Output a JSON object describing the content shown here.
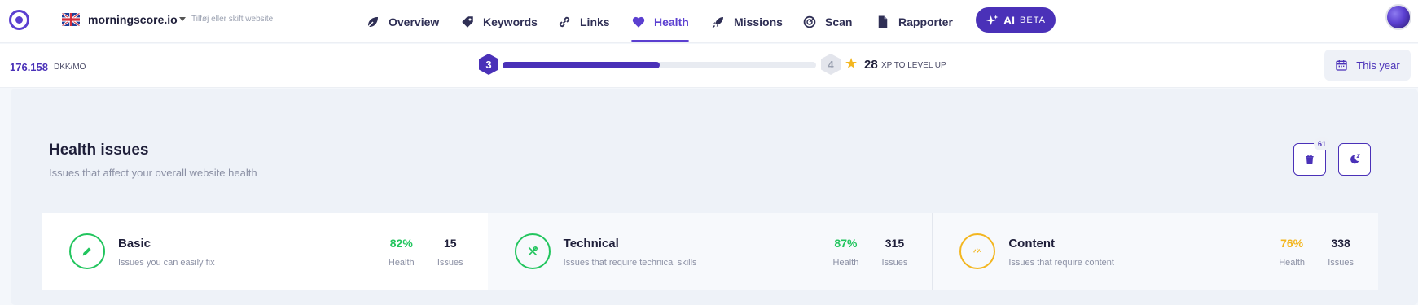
{
  "colors": {
    "accent": "#4a31b8",
    "green": "#22c55e",
    "amber": "#f3b61f",
    "star": "#f3b61f"
  },
  "topnav": {
    "site": {
      "name": "morningscore.io",
      "hint": "Tilføj eller skift website",
      "flag": "uk-flag-icon"
    },
    "items": [
      {
        "label": "Overview",
        "icon": "overview-icon",
        "active": false
      },
      {
        "label": "Keywords",
        "icon": "keyword-tag-icon",
        "active": false
      },
      {
        "label": "Links",
        "icon": "link-icon",
        "active": false
      },
      {
        "label": "Health",
        "icon": "heart-icon",
        "active": true
      },
      {
        "label": "Missions",
        "icon": "rocket-icon",
        "active": false
      },
      {
        "label": "Scan",
        "icon": "scan-icon",
        "active": false
      },
      {
        "label": "Rapporter",
        "icon": "document-icon",
        "active": false
      }
    ],
    "ai": {
      "label": "AI",
      "tag": "BETA",
      "icon": "sparkle-icon"
    }
  },
  "subbar": {
    "value": "176.158",
    "unit": "DKK/MO",
    "level": {
      "current": "3",
      "next": "4",
      "progress_fraction": 0.5
    },
    "xp": {
      "amount": "28",
      "label": "XP TO LEVEL UP"
    },
    "period": {
      "label": "This year",
      "icon": "calendar-icon"
    }
  },
  "health": {
    "title": "Health issues",
    "subtitle": "Issues that affect your overall website health",
    "trash_badge": "61",
    "cards": [
      {
        "title": "Basic",
        "description": "Issues you can easily fix",
        "health": "82%",
        "health_label": "Health",
        "issues": "15",
        "issues_label": "Issues",
        "icon": "pencil-icon",
        "color": "#22c55e",
        "selected": true
      },
      {
        "title": "Technical",
        "description": "Issues that require technical skills",
        "health": "87%",
        "health_label": "Health",
        "issues": "315",
        "issues_label": "Issues",
        "icon": "tools-icon",
        "color": "#22c55e",
        "selected": false
      },
      {
        "title": "Content",
        "description": "Issues that require content",
        "health": "76%",
        "health_label": "Health",
        "issues": "338",
        "issues_label": "Issues",
        "icon": "content-spinner-icon",
        "color": "#f3b61f",
        "selected": false
      }
    ]
  }
}
